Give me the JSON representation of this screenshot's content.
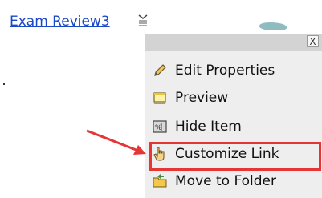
{
  "link": {
    "label": "Exam Review3"
  },
  "menu": {
    "close_label": "X",
    "items": [
      {
        "label": "Edit Properties",
        "icon": "pencil-icon"
      },
      {
        "label": "Preview",
        "icon": "window-icon"
      },
      {
        "label": "Hide Item",
        "icon": "hide-icon"
      },
      {
        "label": "Customize Link",
        "icon": "hand-pointer-icon"
      },
      {
        "label": "Move to Folder",
        "icon": "folder-move-icon"
      }
    ]
  },
  "colors": {
    "link": "#1a49c7",
    "highlight": "#e53535",
    "menu_bg": "#eeeeee",
    "menu_header": "#d3d3d3"
  }
}
